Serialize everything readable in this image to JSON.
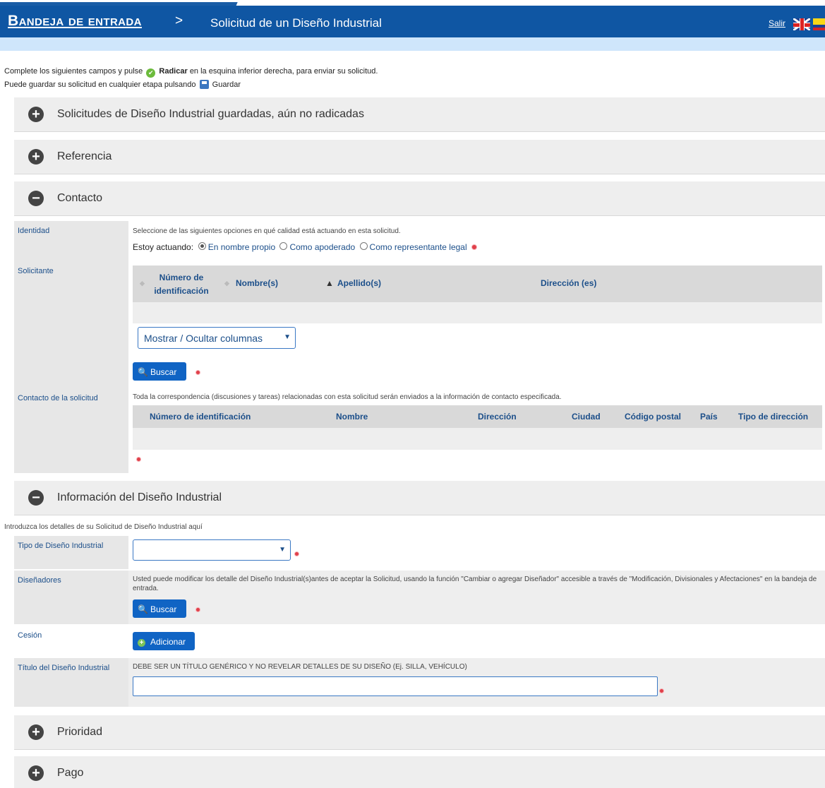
{
  "header": {
    "inbox_label": "Bandeja de entrada",
    "separator": ">",
    "page_title": "Solicitud de un Diseño Industrial",
    "exit_label": "Salir",
    "colors": {
      "header_bg": "#0f56a3",
      "subbar_bg": "#cfe6fb"
    }
  },
  "intro": {
    "line1_before": "Complete los siguientes campos y pulse",
    "line1_bold": "Radicar",
    "line1_after": "en la esquina inferior derecha, para enviar su solicitud.",
    "line2_before": "Puede guardar su solicitud en cualquier etapa pulsando",
    "line2_after": "Guardar"
  },
  "sections": {
    "saved": "Solicitudes de Diseño Industrial guardadas, aún no radicadas",
    "reference": "Referencia",
    "contact": "Contacto",
    "design_info": "Información del Diseño Industrial",
    "priority": "Prioridad",
    "payment": "Pago"
  },
  "contact": {
    "identity_label": "Identidad",
    "identity_help": "Seleccione de las siguientes opciones en qué calidad está actuando en esta solicitud.",
    "acting_label": "Estoy actuando:",
    "acting_options": [
      "En nombre propio",
      "Como apoderado",
      "Como representante legal"
    ],
    "applicant_label": "Solicitante",
    "applicant_columns": [
      "Número de identificación",
      "Nombre(s)",
      "Apellido(s)",
      "Dirección (es)"
    ],
    "columns_toggle": "Mostrar / Ocultar columnas",
    "search_label": "Buscar",
    "contact_label": "Contacto de la solicitud",
    "contact_help": "Toda la correspondencia (discusiones y tareas) relacionadas con esta solicitud serán enviados a la información de contacto especificada.",
    "contact_columns": [
      "Número de identificación",
      "Nombre",
      "Dirección",
      "Ciudad",
      "Código postal",
      "País",
      "Tipo de dirección"
    ]
  },
  "design": {
    "intro": "Introduzca los detalles de su Solicitud de Diseño Industrial aquí",
    "type_label": "Tipo de Diseño Industrial",
    "type_value": "",
    "designers_label": "Diseñadores",
    "designers_help": "Usted puede modificar los detalle del Diseño Industrial(s)antes de aceptar la Solicitud, usando la función \"Cambiar o agregar Diseñador\" accesible a través de \"Modificación, Divisionales y Afectaciones\" en la bandeja de entrada.",
    "search_label": "Buscar",
    "assignment_label": "Cesión",
    "add_label": "Adicionar",
    "title_label": "Título del Diseño Industrial",
    "title_help": "DEBE SER UN TÍTULO GENÉRICO Y NO REVELAR DETALLES DE SU DISEÑO (Ej. SILLA, VEHÍCULO)",
    "title_value": ""
  }
}
